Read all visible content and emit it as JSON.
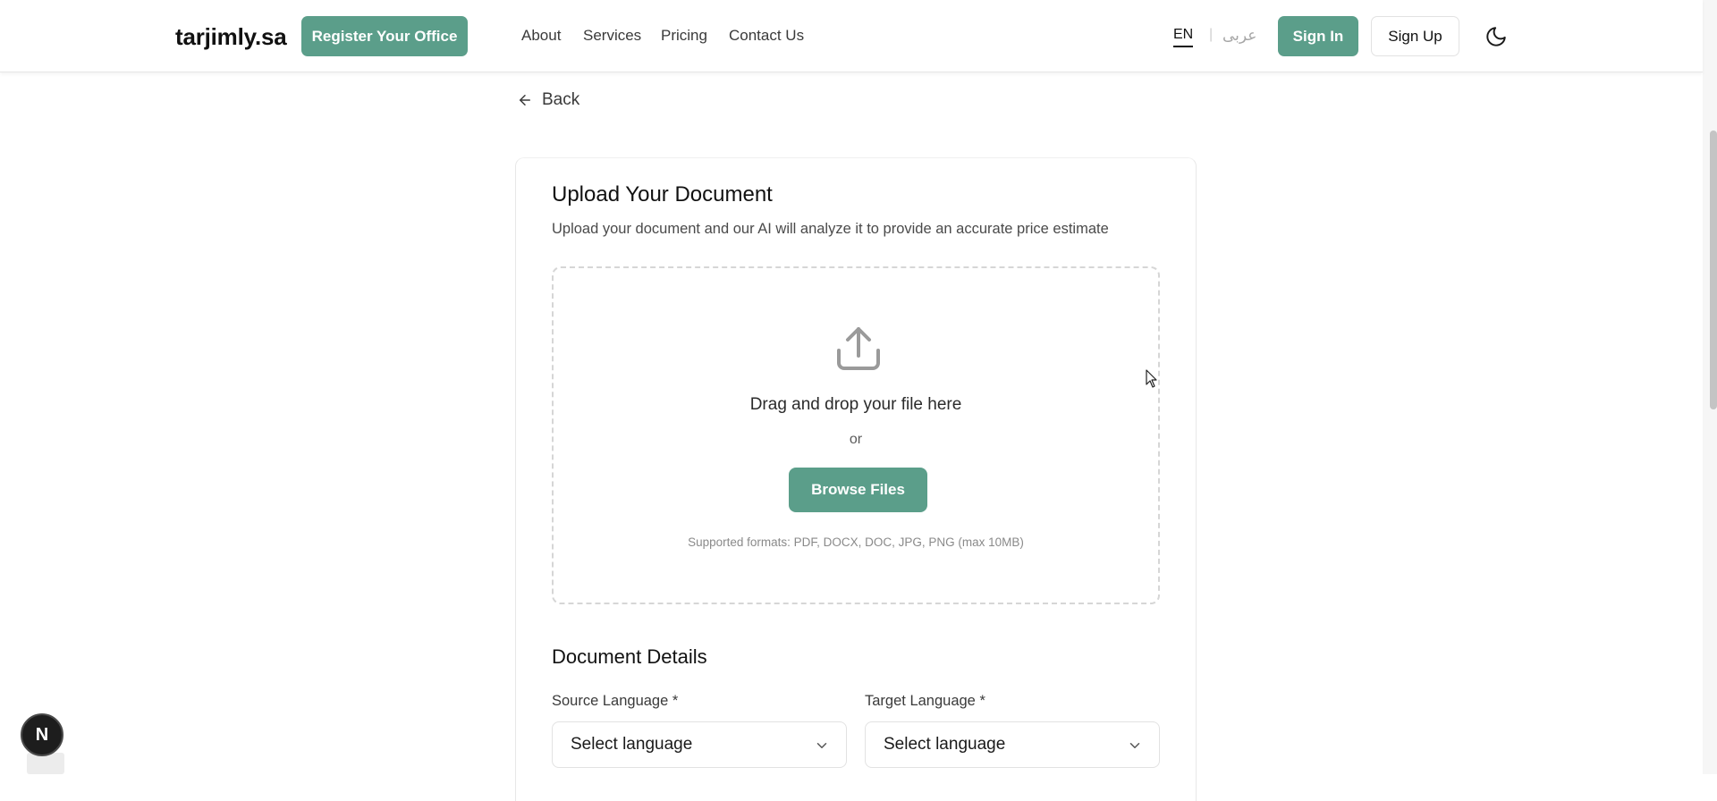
{
  "header": {
    "logo": "tarjimly.sa",
    "register_label": "Register Your Office",
    "nav": {
      "about": "About",
      "services": "Services",
      "pricing": "Pricing",
      "contact": "Contact Us"
    },
    "lang_en": "EN",
    "lang_separator": "|",
    "lang_ar": "عربى",
    "signin_label": "Sign In",
    "signup_label": "Sign Up",
    "theme_icon": "moon-icon"
  },
  "back": {
    "label": "Back",
    "icon": "arrow-left-icon"
  },
  "upload": {
    "title": "Upload Your Document",
    "subtitle": "Upload your document and our AI will analyze it to provide an accurate price estimate",
    "icon": "upload-icon",
    "drop_text": "Drag and drop your file here",
    "or_text": "or",
    "browse_label": "Browse Files",
    "formats": "Supported formats: PDF, DOCX, DOC, JPG, PNG (max 10MB)"
  },
  "details": {
    "title": "Document Details",
    "source_label": "Source Language *",
    "source_value": "Select language",
    "target_label": "Target Language *",
    "target_value": "Select language"
  },
  "dev_badge": {
    "letter": "N"
  },
  "colors": {
    "accent": "#5b9e8a",
    "text": "#1a1a1a",
    "muted": "#8a8a8a",
    "border": "#e2e2e2"
  }
}
